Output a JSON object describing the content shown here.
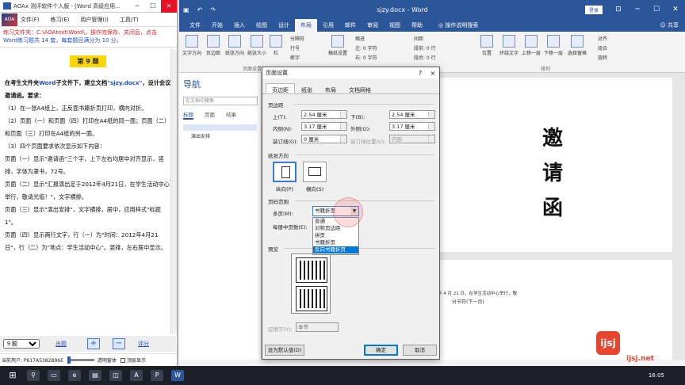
{
  "left_window": {
    "title": "AOAx 测评软件个人版 - [Word 高级应用...",
    "menu": [
      "文件(F)",
      "练习(E)",
      "用户管理(I)",
      "工具(T)"
    ],
    "logo_text": "AOA",
    "info_red": "练习文件夹：C:\\AOAtext\\Word\\，操作完保存、关闭后，点击",
    "info_blue": "Word练习题共 14 套，每套题目满分为 10 分。",
    "question_title": "第 9 题",
    "intro_a": "在考生文件夹",
    "intro_word": "Word",
    "intro_b": "子文件下，建立文档",
    "intro_file": "\"sjzy.docx\"",
    "intro_c": "，设计会议邀请函。要求：",
    "lines": [
      "（1）在一张A4纸上，正反面书籍折页打印，横向对折。",
      "（2）页面（一）和页面（四）打印在A4纸的同一面；页面（二）和页面（三）打印在A4纸的另一面。",
      "（3）四个页面要求依次显示如下内容：",
      "页面（一）显示\"邀请函\"三个字，上下左右均居中对齐显示，竖排，字体为隶书，72号。",
      "页面（二）显示\"汇报演出定于2012年4月21日，在学生活动中心举行，敬请光临！\"，文字横排。",
      "页面（三）显示\"演出安排\"，文字横排，居中，应用样式\"标题 1\"。",
      "页面（四）显示两行文字，行（一）为\"时间：2012年4月21日\"，行（二）为\"地点：学生活动中心\"。竖排，左右居中显示。"
    ],
    "question_select": "9 题",
    "btn_question": "出题",
    "btn_score": "评分",
    "status_user": "当前用户: P617A5382B96E",
    "status_transparency": "透明窗体",
    "status_topmost": "顶层显示"
  },
  "word": {
    "doc_title": "sjzy.docx  -  Word",
    "login": "登录",
    "tabs": [
      "文件",
      "开始",
      "插入",
      "绘图",
      "设计",
      "布局",
      "引用",
      "邮件",
      "审阅",
      "视图",
      "帮助"
    ],
    "active_tab": "布局",
    "tell_me": "操作说明搜索",
    "share": "共享",
    "ribbon": {
      "text_direction": "文字方向",
      "margins": "页边距",
      "orientation": "纸张方向",
      "size": "纸张大小",
      "columns": "栏",
      "breaks": "分隔符",
      "line_numbers": "行号",
      "hyphenation": "断字",
      "manuscript": "稿纸设置",
      "indent_label": "缩进",
      "indent_left": "左: 0 字符",
      "indent_right": "右: 0 字符",
      "spacing_label": "间距",
      "spacing_before": "段前: 0 行",
      "spacing_after": "段后: 0 行",
      "position": "位置",
      "wrap": "环绕文字",
      "forward": "上移一层",
      "backward": "下移一层",
      "selection_pane": "选择窗格",
      "group_page_setup": "页面设置",
      "group_arrange": "排列",
      "align": "对齐",
      "group": "组合",
      "rotate": "旋转"
    },
    "nav": {
      "title": "导航",
      "search_placeholder": "在文档中搜索",
      "tabs": [
        "标题",
        "页面",
        "结果"
      ],
      "items": [
        "演出安排"
      ]
    },
    "doc": {
      "invitation_chars": [
        "邀",
        "请",
        "函"
      ],
      "page2_line": "年 4 月 21 日，在学生活动中心举行，敬",
      "section_break": "分节符(下一页)"
    }
  },
  "dialog": {
    "title": "页面设置",
    "help": "?",
    "close": "×",
    "tabs": [
      "页边距",
      "纸张",
      "布局",
      "文档网格"
    ],
    "active_tab": "页边距",
    "margins_label": "页边距",
    "top_label": "上(T):",
    "top_value": "2.54 厘米",
    "bottom_label": "下(B):",
    "bottom_value": "2.54 厘米",
    "inside_label": "内侧(N):",
    "inside_value": "3.17 厘米",
    "outside_label": "外侧(O):",
    "outside_value": "3.17 厘米",
    "gutter_label": "装订线(G):",
    "gutter_value": "0 厘米",
    "gutter_pos_label": "装订线位置(U):",
    "gutter_pos_value": "内部",
    "orientation_label": "纸张方向",
    "portrait": "纵向(P)",
    "landscape": "横向(S)",
    "pages_label": "页码范围",
    "multiple_label": "多页(M):",
    "multiple_value": "书籍折页",
    "options": [
      "普通",
      "对称页边距",
      "拼页",
      "书籍折页",
      "反向书籍折页"
    ],
    "highlighted_option": "反向书籍折页",
    "sheets_label": "每册中页数(E):",
    "preview_label": "预览",
    "apply_label": "应用于(Y):",
    "apply_value": "本节",
    "set_default": "设为默认值(D)",
    "ok": "确定",
    "cancel": "取消"
  },
  "watermark": {
    "logo": "ijsj",
    "text": "ijsj.net"
  },
  "taskbar": {
    "time": "16:05"
  }
}
